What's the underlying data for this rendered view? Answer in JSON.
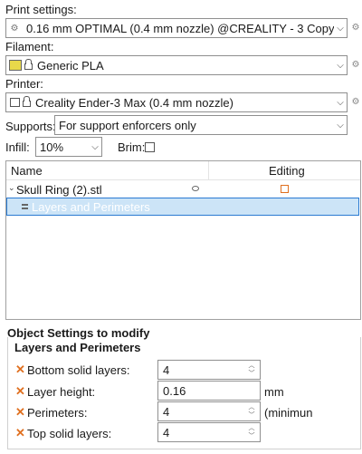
{
  "print_settings": {
    "label": "Print settings:",
    "value": "0.16 mm OPTIMAL (0.4 mm nozzle) @CREALITY - 3 Copy For ..."
  },
  "filament": {
    "label": "Filament:",
    "value": "Generic PLA"
  },
  "printer": {
    "label": "Printer:",
    "value": "Creality Ender-3 Max (0.4 mm nozzle)"
  },
  "supports": {
    "label": "Supports:",
    "value": "For support enforcers only"
  },
  "infill": {
    "label": "Infill:",
    "value": "10%"
  },
  "brim": {
    "label": "Brim:",
    "checked": false
  },
  "object_list": {
    "col_name": "Name",
    "col_editing": "Editing",
    "items": [
      {
        "name": "Skull Ring (2).stl"
      },
      {
        "name": "Layers and Perimeters",
        "selected": true
      }
    ]
  },
  "object_settings": {
    "title": "Object Settings to modify",
    "section": "Layers and Perimeters",
    "fields": [
      {
        "label": "Bottom solid layers:",
        "value": "4",
        "unit": ""
      },
      {
        "label": "Layer height:",
        "value": "0.16",
        "unit": "mm"
      },
      {
        "label": "Perimeters:",
        "value": "4",
        "unit": "(minimun"
      },
      {
        "label": "Top solid layers:",
        "value": "4",
        "unit": ""
      }
    ]
  },
  "colors": {
    "selection": "#cce4f7",
    "selection_border": "#2a7ad2",
    "remove_icon": "#e07020"
  }
}
